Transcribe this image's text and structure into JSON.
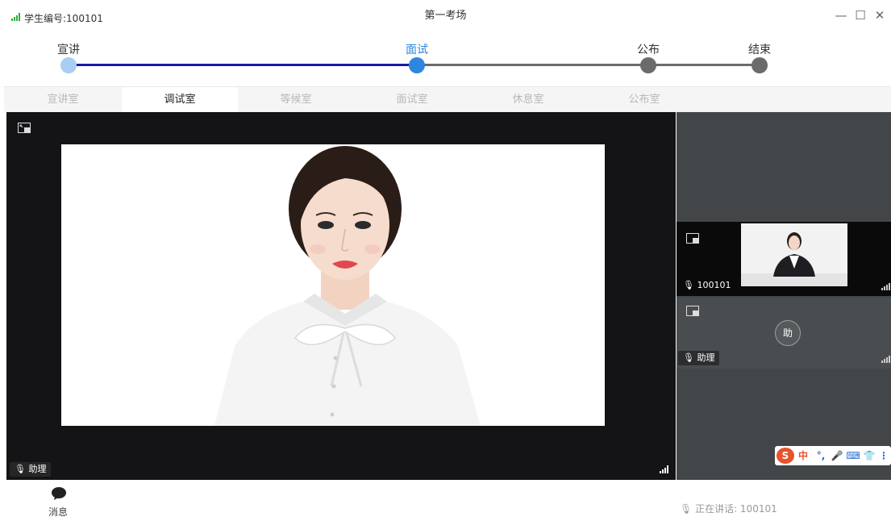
{
  "titlebar": {
    "student_id": "学生编号:100101",
    "title": "第一考场",
    "buttons": {
      "minimize": "—",
      "maximize": "☐",
      "close": "✕"
    }
  },
  "stepper": {
    "steps": [
      {
        "label": "宣讲",
        "state": "done"
      },
      {
        "label": "面试",
        "state": "current"
      },
      {
        "label": "公布",
        "state": "pending"
      },
      {
        "label": "结束",
        "state": "pending"
      }
    ],
    "colors": {
      "done_dot": "#a8cff2",
      "done_line": "#1a1aa6",
      "current": "#2f86de",
      "pending": "#6b6b6b"
    }
  },
  "tabs": [
    {
      "label": "宣讲室",
      "active": false
    },
    {
      "label": "调试室",
      "active": true
    },
    {
      "label": "等候室",
      "active": false
    },
    {
      "label": "面试室",
      "active": false
    },
    {
      "label": "休息室",
      "active": false
    },
    {
      "label": "公布室",
      "active": false
    }
  ],
  "main_video": {
    "label": "助理",
    "icon": "pip-icon"
  },
  "side_tiles": [
    {
      "label": "100101",
      "icon": "pip-icon"
    },
    {
      "label": "助理",
      "avatar_text": "助",
      "icon": "pip-icon"
    }
  ],
  "ime_toolbar": {
    "brand": "S",
    "items": [
      "中",
      "°,",
      "🎤",
      "⌨",
      "👕",
      "⋮"
    ]
  },
  "bottom": {
    "message_label": "消息",
    "speaking": "正在讲话: 100101"
  }
}
